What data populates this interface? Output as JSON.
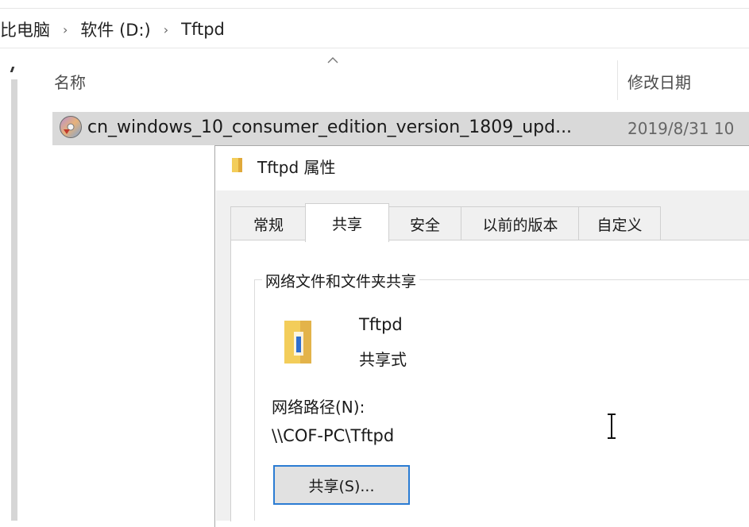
{
  "address_bar": {
    "crumbs": [
      "比电脑",
      "软件 (D:)",
      "Tftpd"
    ],
    "separator": "›"
  },
  "file_list": {
    "sort_indicator": "^",
    "columns": {
      "name": "名称",
      "modified": "修改日期"
    },
    "rows": [
      {
        "name": "cn_windows_10_consumer_edition_version_1809_upd...",
        "modified": "2019/8/31 10",
        "icon": "disc-image-icon",
        "selected": true
      }
    ]
  },
  "properties_dialog": {
    "title": "Tftpd 属性",
    "title_icon": "folder-icon",
    "tabs": [
      "常规",
      "共享",
      "安全",
      "以前的版本",
      "自定义"
    ],
    "active_tab": "共享",
    "group_label": "网络文件和文件夹共享",
    "folder": {
      "name": "Tftpd",
      "state": "共享式",
      "icon": "shared-folder-icon"
    },
    "network_path_label": "网络路径(N):",
    "network_path_value": "\\\\COF-PC\\Tftpd",
    "share_button": "共享(S)..."
  },
  "colors": {
    "accent": "#2b7cd3",
    "selection": "#d9d9d9",
    "dialog_background": "#f0f0f0",
    "folder_yellow": "#f3cd5a"
  }
}
